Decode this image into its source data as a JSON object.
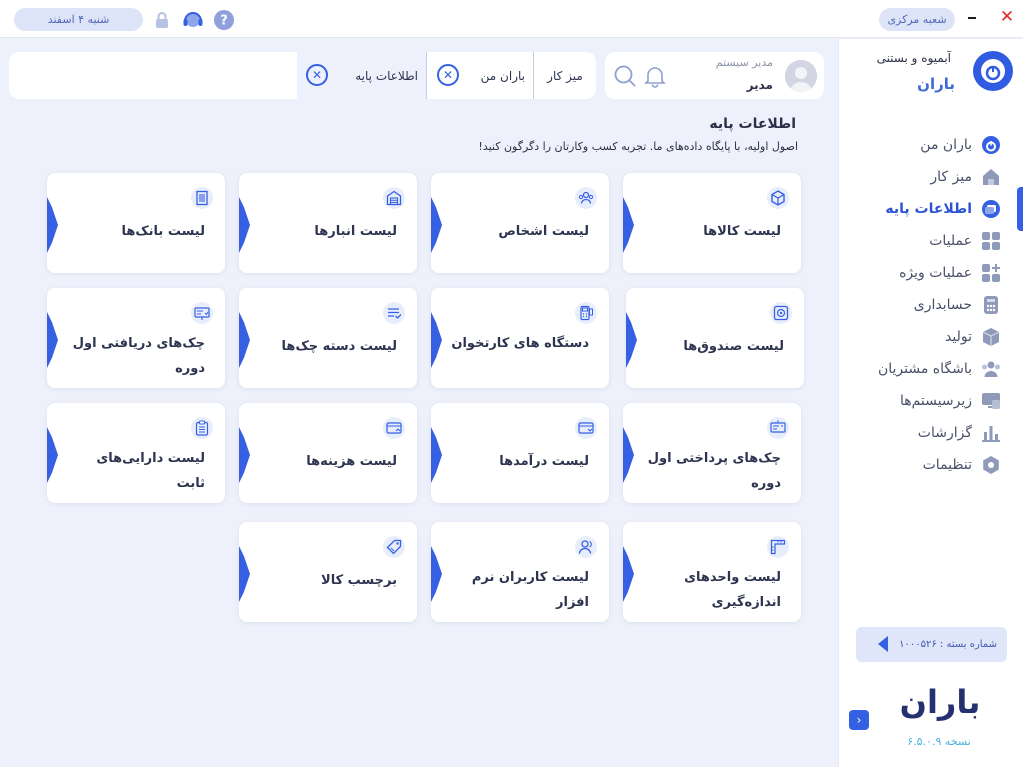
{
  "topbar": {
    "date": "شنبه ۴ اسفند",
    "branch": "شعبه مرکزی",
    "close_label": "✕",
    "minimize_label": "–"
  },
  "sidebar": {
    "company": "آبمیوه و بستنی",
    "app_name": "باران",
    "items": [
      {
        "label": "باران من",
        "icon": "baran-logo-icon"
      },
      {
        "label": "میز کار",
        "icon": "home-icon"
      },
      {
        "label": "اطلاعات پایه",
        "icon": "base-info-icon",
        "active": true
      },
      {
        "label": "عملیات",
        "icon": "grid-icon"
      },
      {
        "label": "عملیات ویژه",
        "icon": "grid-plus-icon"
      },
      {
        "label": "حسابداری",
        "icon": "calculator-icon"
      },
      {
        "label": "تولید",
        "icon": "box-icon"
      },
      {
        "label": "باشگاه مشتریان",
        "icon": "users-icon"
      },
      {
        "label": "زیرسیستم‌ها",
        "icon": "monitor-icon"
      },
      {
        "label": "گزارشات",
        "icon": "chart-icon"
      },
      {
        "label": "تنظیمات",
        "icon": "gear-icon"
      }
    ],
    "package_label": "شماره بسته : ۱۰۰۰۵۲۶",
    "brand": "باران",
    "version": "نسخه ۶.۵.۰.۹"
  },
  "header": {
    "tabs": [
      {
        "label": "میز کار",
        "closable": false
      },
      {
        "label": "باران من",
        "closable": true
      },
      {
        "label": "اطلاعات پایه",
        "closable": true,
        "active": true
      }
    ],
    "user_role": "مدیر سیستم",
    "user_name": "مدیر"
  },
  "main": {
    "title": "اطلاعات پایه",
    "subtitle": "اصول اولیه، با پایگاه داده‌های ما. تجربه کسب وکارتان را دگرگون کنید!",
    "cards": [
      {
        "label": "لیست کالاها",
        "icon": "cube-icon"
      },
      {
        "label": "لیست اشخاص",
        "icon": "people-icon"
      },
      {
        "label": "لیست انبارها",
        "icon": "warehouse-icon"
      },
      {
        "label": "لیست بانک‌ها",
        "icon": "bank-icon"
      },
      {
        "label": "لیست صندوق‌ها",
        "icon": "safe-icon"
      },
      {
        "label": "دستگاه های کارتخوان",
        "icon": "pos-device-icon"
      },
      {
        "label": "لیست دسته چک‌ها",
        "icon": "checkbook-icon"
      },
      {
        "label": "چک‌های دریافتی اول دوره",
        "icon": "received-check-icon"
      },
      {
        "label": "چک‌های پرداختی اول دوره",
        "icon": "paid-check-icon"
      },
      {
        "label": "لیست درآمدها",
        "icon": "income-icon"
      },
      {
        "label": "لیست هزینه‌ها",
        "icon": "expense-icon"
      },
      {
        "label": "لیست دارایی‌های ثابت",
        "icon": "clipboard-icon"
      },
      {
        "label": "لیست واحدهای اندازه‌گیری",
        "icon": "ruler-icon"
      },
      {
        "label": "لیست کاربران نرم افزار",
        "icon": "user-icon"
      },
      {
        "label": "برچسب کالا",
        "icon": "tag-icon"
      }
    ]
  },
  "colors": {
    "accent": "#3560e3",
    "background": "#eef1fb",
    "active_text": "#2e54d6",
    "version_text": "#4bb0e0",
    "close_red": "#e5292b"
  }
}
